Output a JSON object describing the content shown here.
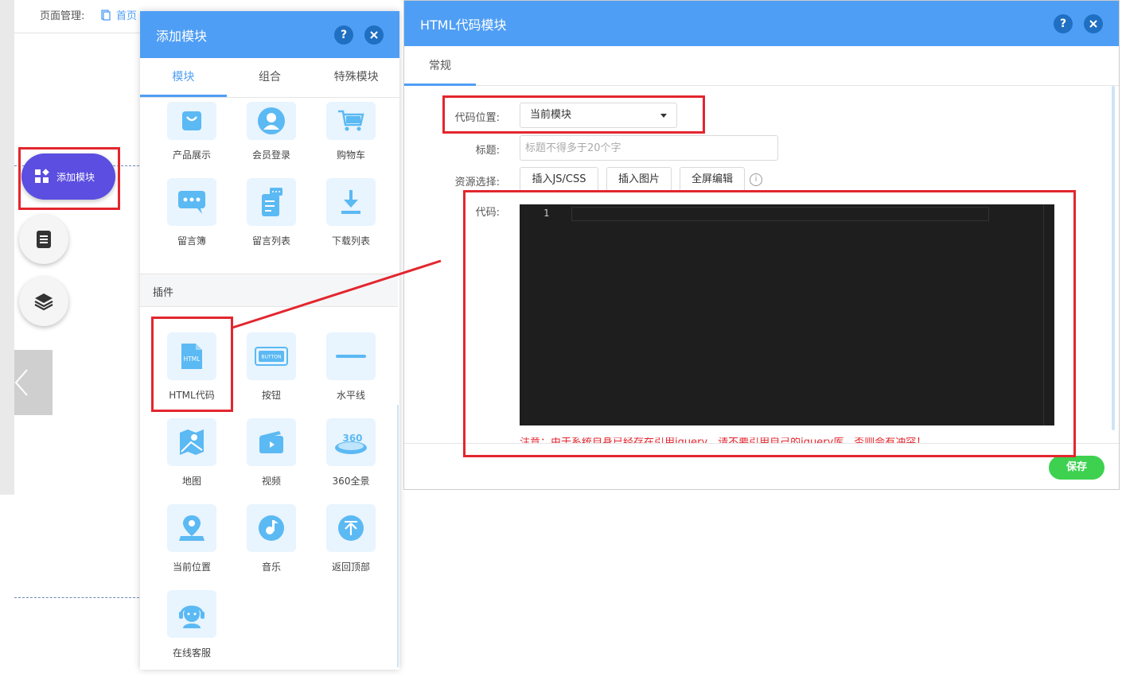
{
  "topbar": {
    "page_manage_label": "页面管理:",
    "home_label": "首页"
  },
  "floating": {
    "add_module_label": "添加模块"
  },
  "add_panel": {
    "title": "添加模块",
    "tabs": [
      "模块",
      "组合",
      "特殊模块"
    ],
    "modules": [
      {
        "label": "产品展示",
        "icon": "bag-icon"
      },
      {
        "label": "会员登录",
        "icon": "user-icon"
      },
      {
        "label": "购物车",
        "icon": "cart-icon"
      },
      {
        "label": "留言簿",
        "icon": "chat-icon"
      },
      {
        "label": "留言列表",
        "icon": "message-list-icon"
      },
      {
        "label": "下载列表",
        "icon": "download-icon"
      }
    ],
    "plugin_section_label": "插件",
    "plugins": [
      {
        "label": "HTML代码",
        "icon": "html-file-icon",
        "icon_text": "HTML"
      },
      {
        "label": "按钮",
        "icon": "button-icon",
        "icon_text": "BUTTON"
      },
      {
        "label": "水平线",
        "icon": "horizontal-line-icon"
      },
      {
        "label": "地图",
        "icon": "map-icon"
      },
      {
        "label": "视频",
        "icon": "video-icon"
      },
      {
        "label": "360全景",
        "icon": "panorama-360-icon",
        "icon_text": "360"
      },
      {
        "label": "当前位置",
        "icon": "location-icon"
      },
      {
        "label": "音乐",
        "icon": "music-icon"
      },
      {
        "label": "返回顶部",
        "icon": "back-to-top-icon"
      },
      {
        "label": "在线客服",
        "icon": "customer-service-icon"
      }
    ]
  },
  "html_dialog": {
    "title": "HTML代码模块",
    "tab_general": "常规",
    "code_position_label": "代码位置:",
    "code_position_value": "当前模块",
    "title_label": "标题:",
    "title_placeholder": "标题不得多于20个字",
    "resource_label": "资源选择:",
    "resource_buttons": [
      "插入JS/CSS",
      "插入图片",
      "全屏编辑"
    ],
    "code_label": "代码:",
    "line_number": "1",
    "warning_text": "注意：由于系统自身已经存在引用jquery，请不要引用自己的jquery库，否则会有冲突！",
    "save_label": "保存"
  },
  "colors": {
    "primary": "#4f9ef5",
    "save": "#3dd14f",
    "annotation": "#e3262e",
    "fab": "#5b4ee0"
  }
}
